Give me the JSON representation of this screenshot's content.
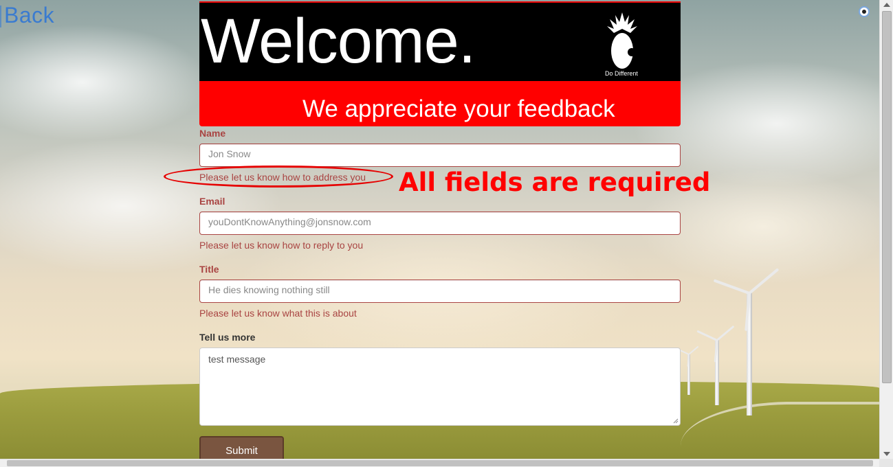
{
  "nav": {
    "back_label": "Back"
  },
  "header": {
    "welcome": "Welcome.",
    "logo_text": "Do Different",
    "tagline": "We appreciate your feedback"
  },
  "form": {
    "name": {
      "label": "Name",
      "value": "Jon Snow",
      "help": "Please let us know how to address you"
    },
    "email": {
      "label": "Email",
      "value": "youDontKnowAnything@jonsnow.com",
      "help": "Please let us know how to reply to you"
    },
    "title": {
      "label": "Title",
      "value": "He dies knowing nothing still",
      "help": "Please let us know what this is about"
    },
    "message": {
      "label": "Tell us more",
      "value": "test message"
    },
    "submit_label": "Submit"
  },
  "annotation": {
    "text": "All fields are required"
  },
  "colors": {
    "header_black": "#000000",
    "header_red": "#ff0000",
    "error": "#a94442",
    "submit": "#7a5540",
    "annotation": "#ff0000",
    "link": "#3a7bd0"
  }
}
